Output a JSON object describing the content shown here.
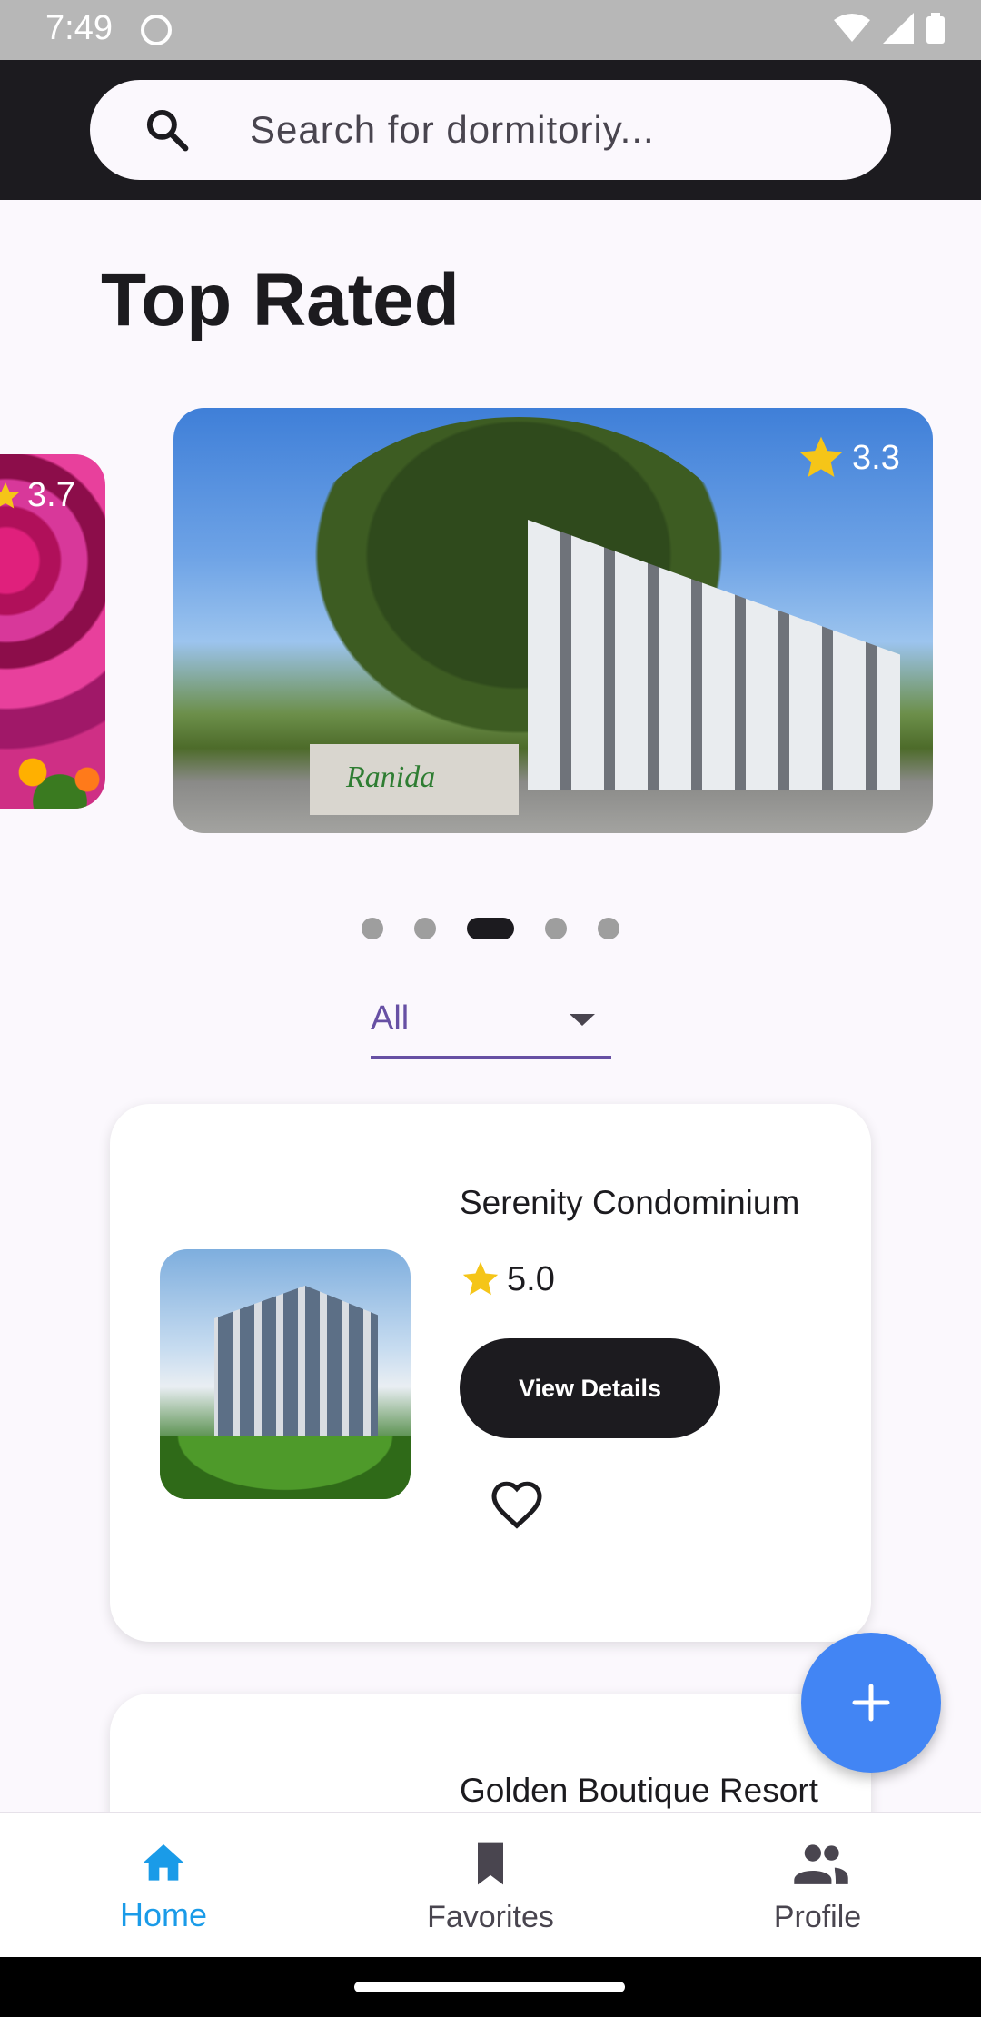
{
  "status_bar": {
    "time": "7:49"
  },
  "search": {
    "placeholder": "Search for dormitoriy...",
    "value": ""
  },
  "top_rated": {
    "title": "Top Rated",
    "cards": [
      {
        "rating": "3.7"
      },
      {
        "rating": "3.3"
      }
    ],
    "dots_total": 5,
    "dots_active_index": 2
  },
  "filter": {
    "selected": "All"
  },
  "dormitories": [
    {
      "name": "Serenity Condominium",
      "rating": "5.0",
      "button": "View Details"
    },
    {
      "name": "Golden Boutique Resort"
    }
  ],
  "bottom_nav": {
    "items": [
      {
        "label": "Home",
        "icon": "home-icon",
        "active": true
      },
      {
        "label": "Favorites",
        "icon": "bookmark-icon",
        "active": false
      },
      {
        "label": "Profile",
        "icon": "people-icon",
        "active": false
      }
    ]
  },
  "colors": {
    "accent": "#6750a4",
    "fab": "#4285f4",
    "nav_active": "#1a9be8",
    "star": "#f5c518",
    "header": "#1c1b1f"
  }
}
